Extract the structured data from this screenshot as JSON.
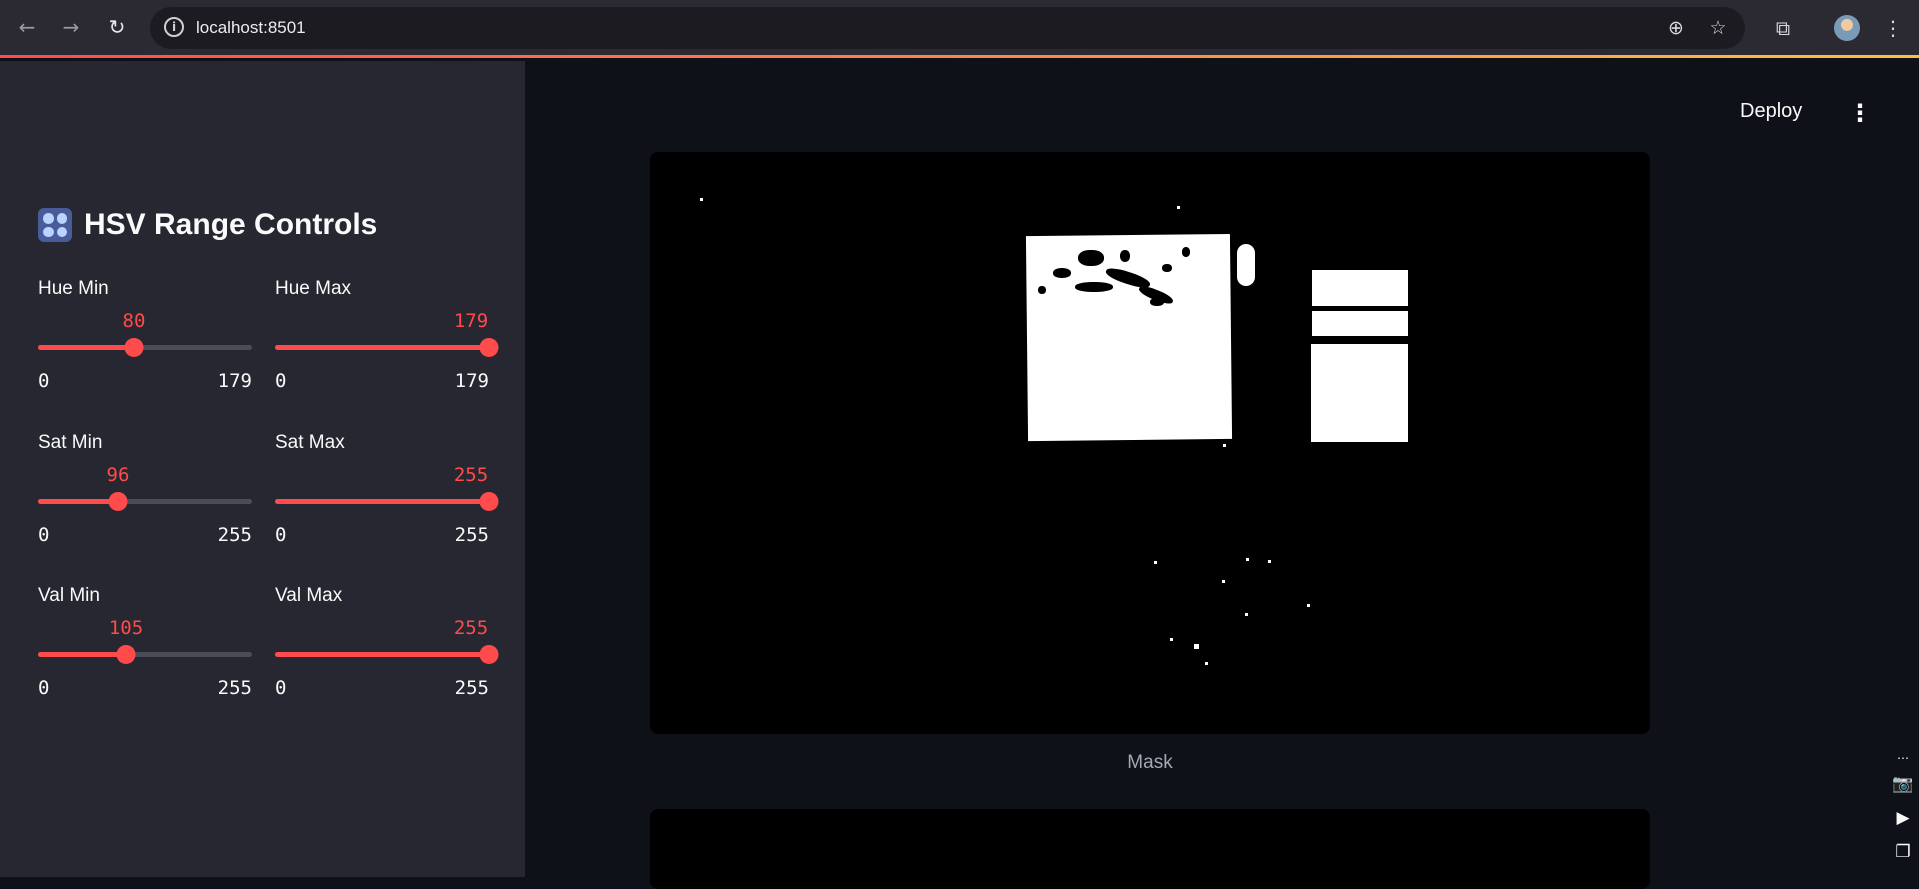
{
  "browser": {
    "url": "localhost:8501",
    "back_icon": "←",
    "forward_icon": "→",
    "reload_icon": "↻",
    "info_icon": "i",
    "zoom_icon": "⊕",
    "star_icon": "☆",
    "extensions_icon": "⧉",
    "menu_icon": "⋮"
  },
  "header": {
    "deploy_label": "Deploy",
    "menu_icon": "⋮"
  },
  "sidebar": {
    "title": "HSV Range Controls",
    "sliders": [
      {
        "label": "Hue Min",
        "value": "80",
        "min": "0",
        "max": "179",
        "fraction": 0.447
      },
      {
        "label": "Hue Max",
        "value": "179",
        "min": "0",
        "max": "179",
        "fraction": 1.0
      },
      {
        "label": "Sat Min",
        "value": "96",
        "min": "0",
        "max": "255",
        "fraction": 0.376
      },
      {
        "label": "Sat Max",
        "value": "255",
        "min": "0",
        "max": "255",
        "fraction": 1.0
      },
      {
        "label": "Val Min",
        "value": "105",
        "min": "0",
        "max": "255",
        "fraction": 0.412
      },
      {
        "label": "Val Max",
        "value": "255",
        "min": "0",
        "max": "255",
        "fraction": 1.0
      }
    ]
  },
  "main": {
    "image_caption": "Mask"
  },
  "side_tools": {
    "more_icon": "⋯",
    "camera_icon": "📷",
    "video_icon": "▶",
    "window_icon": "❐"
  },
  "colors": {
    "accent": "#ff4b4b",
    "sidebar_bg": "#262730",
    "main_bg": "#0e1117"
  }
}
